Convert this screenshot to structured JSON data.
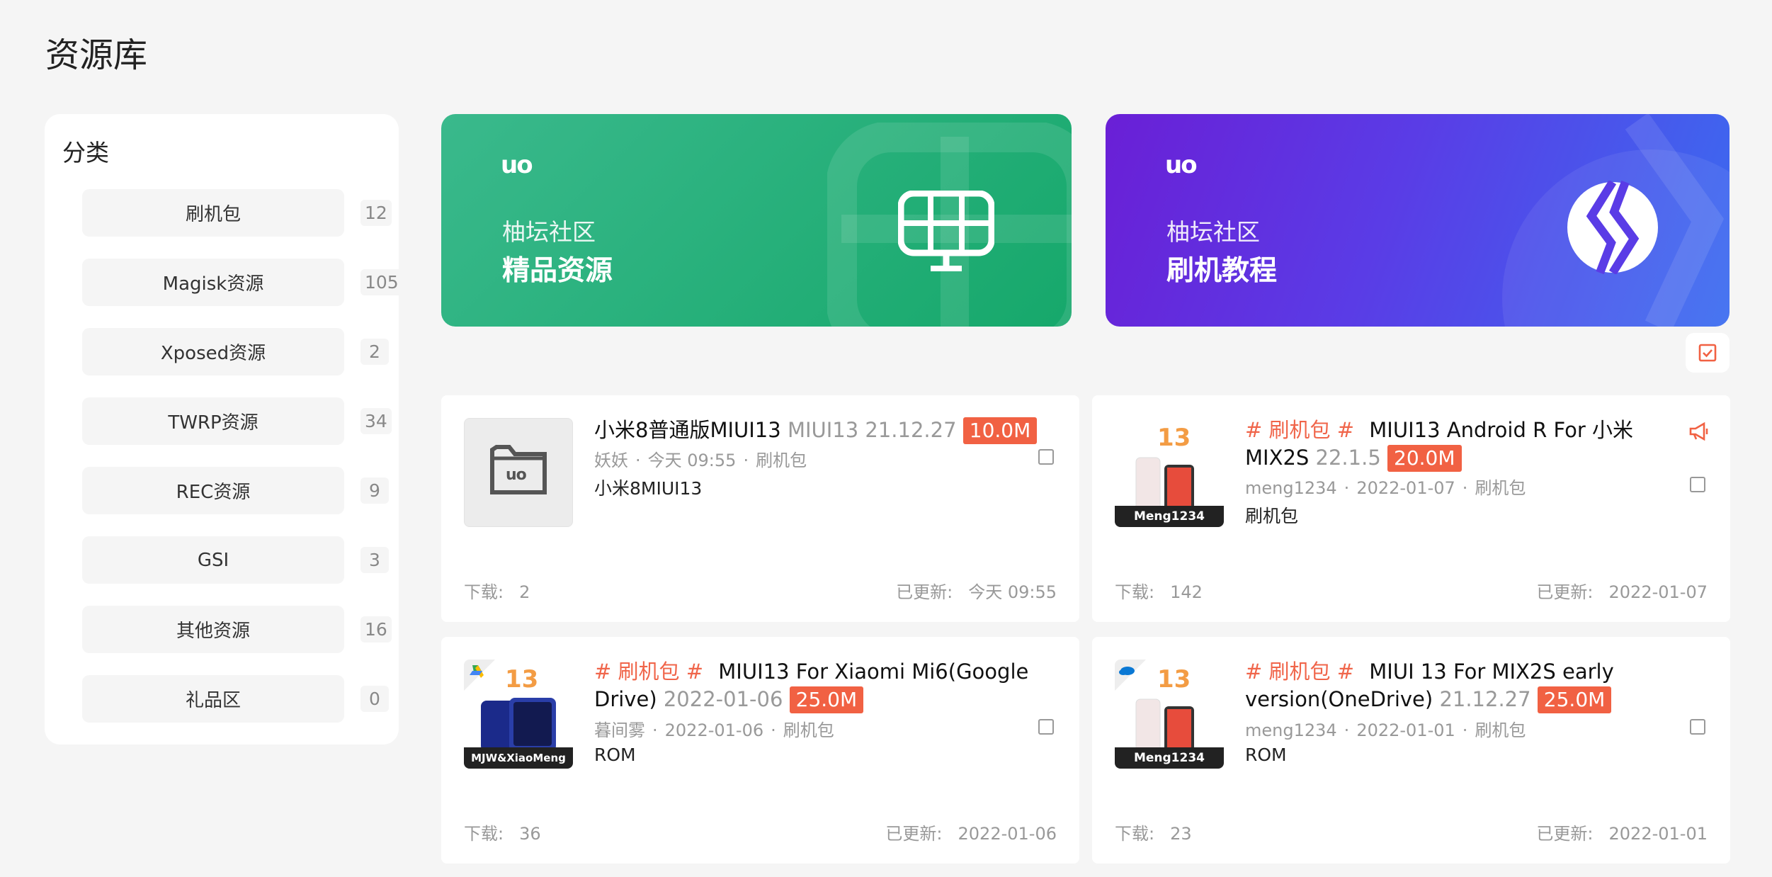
{
  "page": {
    "title": "资源库"
  },
  "sidebar": {
    "title": "分类",
    "items": [
      {
        "label": "刷机包",
        "count": "12"
      },
      {
        "label": "Magisk资源",
        "count": "105"
      },
      {
        "label": "Xposed资源",
        "count": "2"
      },
      {
        "label": "TWRP资源",
        "count": "34"
      },
      {
        "label": "REC资源",
        "count": "9"
      },
      {
        "label": "GSI",
        "count": "3"
      },
      {
        "label": "其他资源",
        "count": "16"
      },
      {
        "label": "礼品区",
        "count": "0"
      }
    ]
  },
  "banners": [
    {
      "logo": "uo",
      "subtitle": "柚坛社区",
      "title": "精品资源",
      "color": "#1fae74"
    },
    {
      "logo": "uo",
      "subtitle": "柚坛社区",
      "title": "刷机教程",
      "color": "#5a3ce6"
    }
  ],
  "cards": [
    {
      "tag": "",
      "title": "小米8普通版MIUI13",
      "version": "MIUI13 21.12.27",
      "size": "10.0M",
      "author": "妖妖",
      "date": "今天 09:55",
      "category": "刷机包",
      "desc": "小米8MIUI13",
      "downloads_label": "下载:",
      "downloads": "2",
      "updated_label": "已更新:",
      "updated": "今天 09:55",
      "thumb_logo": "uo"
    },
    {
      "tag": "# 刷机包 #",
      "title": "MIUI13 Android R For 小米MIX2S",
      "version": "22.1.5",
      "size": "20.0M",
      "author": "meng1234",
      "date": "2022-01-07",
      "category": "刷机包",
      "desc": "刷机包",
      "downloads_label": "下载:",
      "downloads": "142",
      "updated_label": "已更新:",
      "updated": "2022-01-07",
      "badge": "Meng1234",
      "thumb_num": "13"
    },
    {
      "tag": "# 刷机包 #",
      "title": "MIUI13 For Xiaomi Mi6(Google Drive)",
      "version": "2022-01-06",
      "size": "25.0M",
      "author": "暮间雾",
      "date": "2022-01-06",
      "category": "刷机包",
      "desc": "ROM",
      "downloads_label": "下载:",
      "downloads": "36",
      "updated_label": "已更新:",
      "updated": "2022-01-06",
      "badge": "MJW&XiaoMeng",
      "thumb_num": "13"
    },
    {
      "tag": "# 刷机包 #",
      "title": "MIUI 13 For MIX2S early version(OneDrive)",
      "version": "21.12.27",
      "size": "25.0M",
      "author": "meng1234",
      "date": "2022-01-01",
      "category": "刷机包",
      "desc": "ROM",
      "downloads_label": "下载:",
      "downloads": "23",
      "updated_label": "已更新:",
      "updated": "2022-01-01",
      "badge": "Meng1234",
      "thumb_num": "13"
    }
  ],
  "colors": {
    "accent": "#f16143",
    "tag": "#f0654a",
    "green": "#1fae74",
    "purple": "#5a3ce6"
  },
  "icons": {
    "check": "check-square-icon",
    "announce": "megaphone-icon",
    "folder": "folder-icon"
  }
}
